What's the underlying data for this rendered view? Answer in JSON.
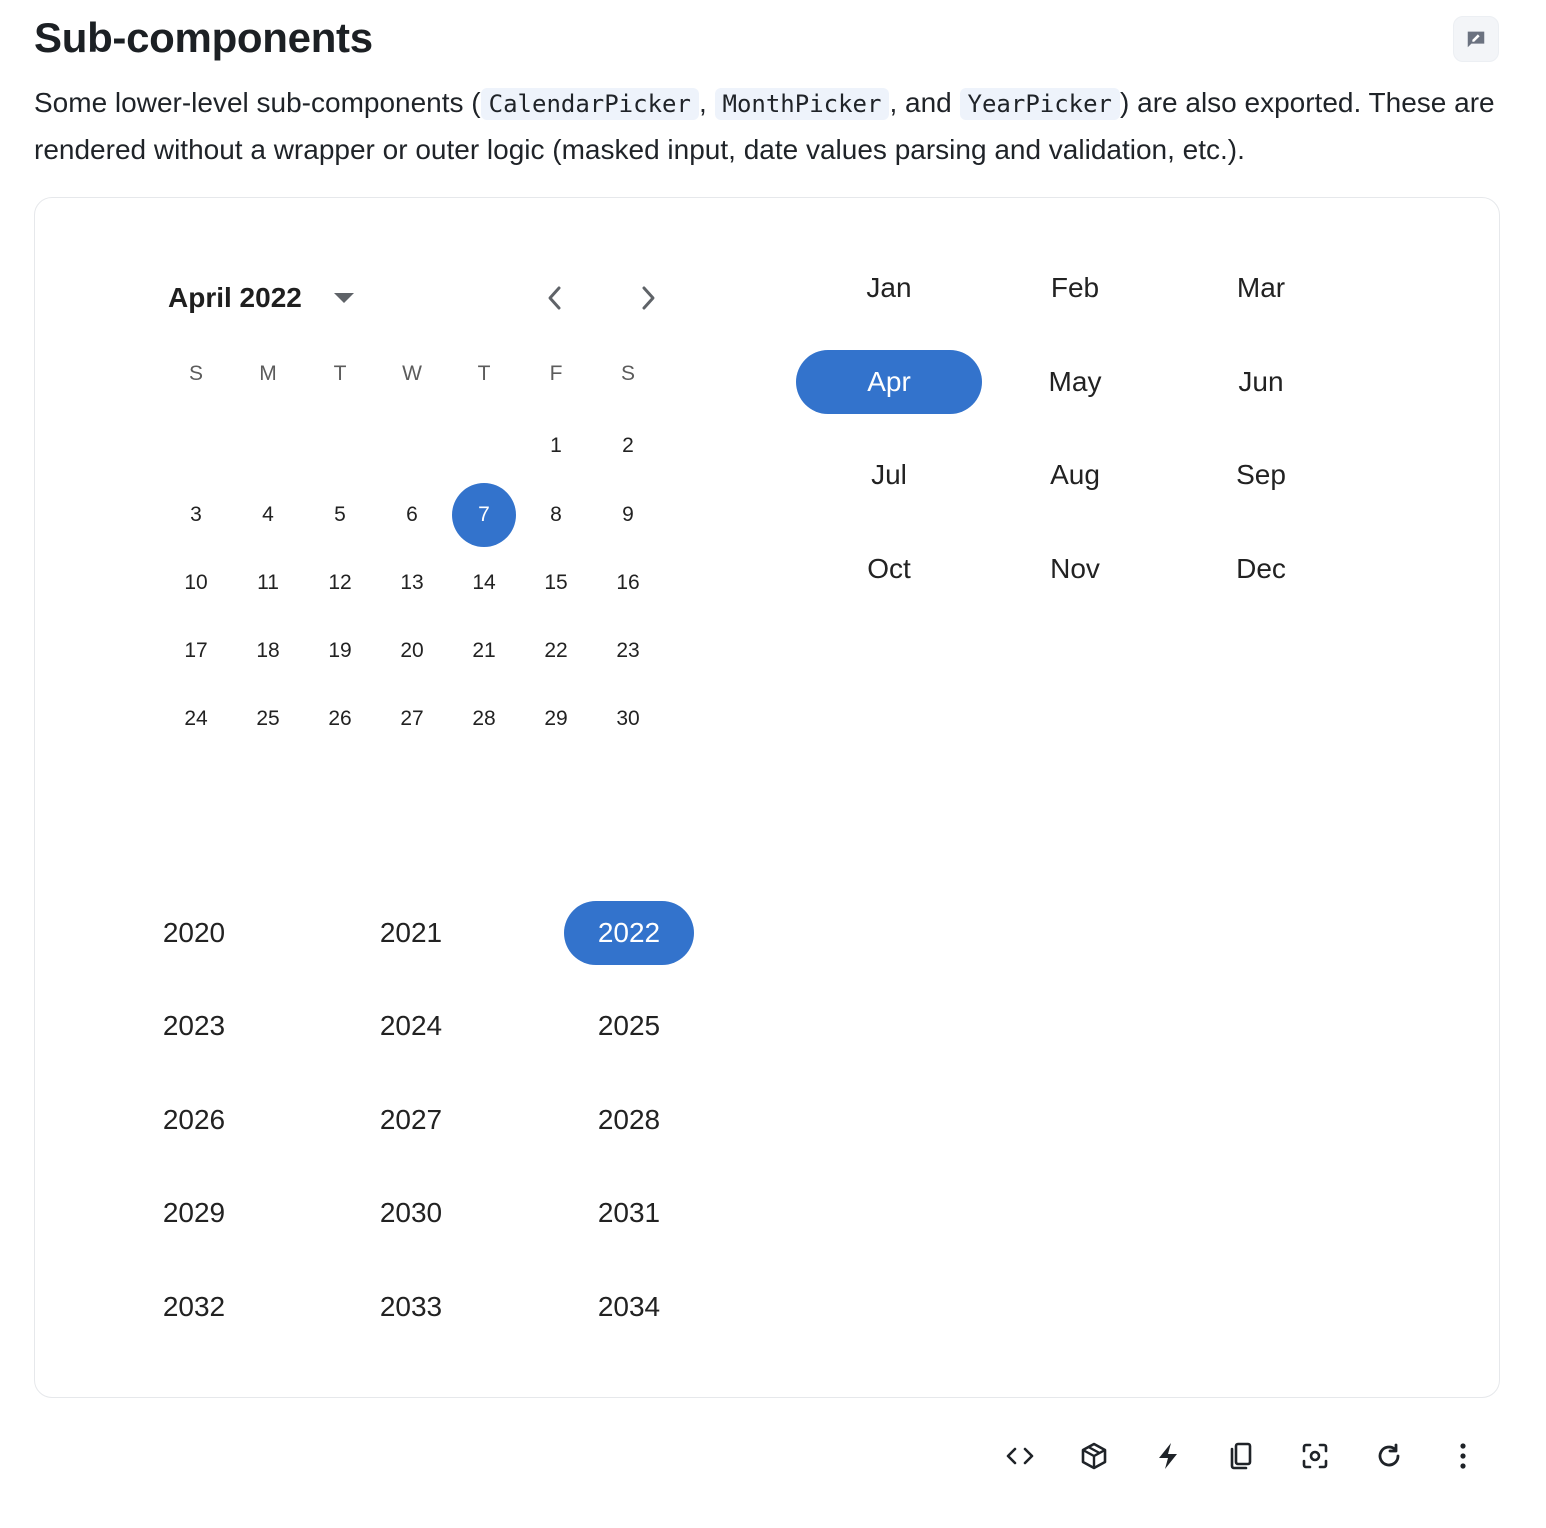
{
  "page": {
    "title": "Sub-components",
    "intro": {
      "text_before": "Some lower-level sub-components (",
      "code1": "CalendarPicker",
      "sep1": ",",
      "code2": "MonthPicker",
      "sep2": ", and",
      "code3": "YearPicker",
      "text_after": ") are also exported. These are rendered without a wrapper or outer logic (masked input, date values parsing and validation, etc.)."
    }
  },
  "calendar": {
    "title": "April 2022",
    "weekdays": [
      "S",
      "M",
      "T",
      "W",
      "T",
      "F",
      "S"
    ],
    "days": [
      "1",
      "2",
      "3",
      "4",
      "5",
      "6",
      "7",
      "8",
      "9",
      "10",
      "11",
      "12",
      "13",
      "14",
      "15",
      "16",
      "17",
      "18",
      "19",
      "20",
      "21",
      "22",
      "23",
      "24",
      "25",
      "26",
      "27",
      "28",
      "29",
      "30"
    ],
    "first_weekday_index": 5,
    "selected_day": "7",
    "prev_icon": "chevron-left-icon",
    "next_icon": "chevron-right-icon",
    "dropdown_icon": "caret-down-icon"
  },
  "month_picker": {
    "months": [
      "Jan",
      "Feb",
      "Mar",
      "Apr",
      "May",
      "Jun",
      "Jul",
      "Aug",
      "Sep",
      "Oct",
      "Nov",
      "Dec"
    ],
    "selected": "Apr"
  },
  "year_picker": {
    "years": [
      "2020",
      "2021",
      "2022",
      "2023",
      "2024",
      "2025",
      "2026",
      "2027",
      "2028",
      "2029",
      "2030",
      "2031",
      "2032",
      "2033",
      "2034"
    ],
    "selected": "2022"
  },
  "toolbar": {
    "icons": [
      "code-icon",
      "package-icon",
      "lightning-icon",
      "copy-icon",
      "screenshot-icon",
      "refresh-icon",
      "more-vertical-icon"
    ]
  },
  "colors": {
    "accent": "#3373cc",
    "code_bg": "#eef3fb",
    "border": "#e6e8eb"
  }
}
